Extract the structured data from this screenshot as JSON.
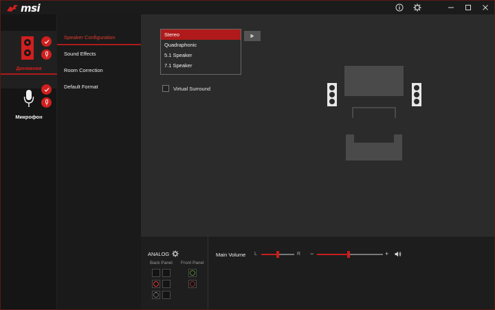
{
  "app": {
    "brand": "msi",
    "window_controls": [
      "info-icon",
      "settings-icon",
      "minimize-icon",
      "maximize-icon",
      "close-icon"
    ],
    "accent_color": "#d11f1f"
  },
  "devices": [
    {
      "label": "Динамики",
      "icon": "speaker-icon",
      "active": true
    },
    {
      "label": "Микрофон",
      "icon": "microphone-icon",
      "active": false
    }
  ],
  "tabs": [
    {
      "label": "Speaker Configuration",
      "active": true
    },
    {
      "label": "Sound Effects",
      "active": false
    },
    {
      "label": "Room Correction",
      "active": false
    },
    {
      "label": "Default Format",
      "active": false
    }
  ],
  "speaker_config": {
    "options": [
      "Stereo",
      "Quadraphonic",
      "5.1 Speaker",
      "7.1 Speaker"
    ],
    "selected": "Stereo",
    "play_icon": "play-icon"
  },
  "virtual_surround": {
    "label": "Virtual Surround",
    "checked": false
  },
  "analog": {
    "title": "ANALOG",
    "back_panel_label": "Back Panel",
    "front_panel_label": "Front Panel",
    "jack_colors": {
      "pink": "#e23a3a",
      "green": "#5a8a3a",
      "black": "#cccccc",
      "front_pink": "#8a2a2a"
    }
  },
  "volume": {
    "label": "Main Volume",
    "left_label": "L",
    "right_label": "R",
    "minus_label": "−",
    "plus_label": "+",
    "balance": 0.5,
    "level": 0.48
  }
}
